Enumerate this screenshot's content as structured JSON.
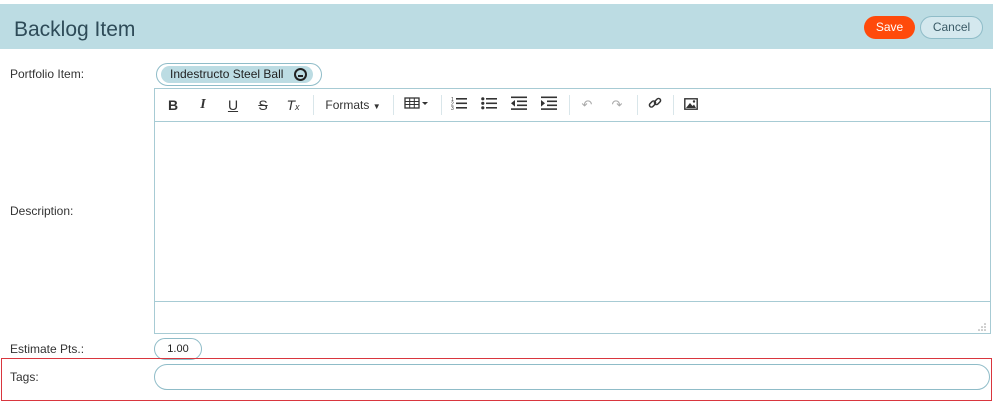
{
  "header": {
    "title": "Backlog Item",
    "save_label": "Save",
    "cancel_label": "Cancel"
  },
  "colors": {
    "header_bg": "#bcdce3",
    "save_bg": "#ff4a0b",
    "highlight_border": "#d9363e"
  },
  "form": {
    "portfolio_item": {
      "label": "Portfolio Item:",
      "chip": "Indestructo Steel Ball"
    },
    "description": {
      "label": "Description:",
      "toolbar": {
        "formats_label": "Formats",
        "icons": [
          "bold-icon",
          "italic-icon",
          "underline-icon",
          "strikethrough-icon",
          "clear-formatting-icon",
          "table-icon",
          "numbered-list-icon",
          "bullet-list-icon",
          "outdent-icon",
          "indent-icon",
          "undo-icon",
          "redo-icon",
          "link-icon",
          "image-icon"
        ]
      },
      "value": ""
    },
    "estimate": {
      "label": "Estimate Pts.:",
      "value": "1.00"
    },
    "tags": {
      "label": "Tags:",
      "value": ""
    }
  }
}
